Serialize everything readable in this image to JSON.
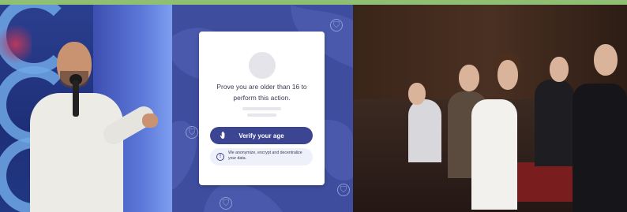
{
  "verification": {
    "prompt": "Prove you are older than 16 to perform this action.",
    "verify_button_label": "Verify your age",
    "privacy_note": "We anonymize, encrypt and decentralize your data."
  },
  "colors": {
    "accent": "#3b4591",
    "panel_bg": "#3f4d9e",
    "top_bar": "#8fbf73"
  },
  "icons": {
    "verify_button_icon": "hand-icon",
    "privacy_icon": "info-icon",
    "background_icons": "shield-icon"
  }
}
